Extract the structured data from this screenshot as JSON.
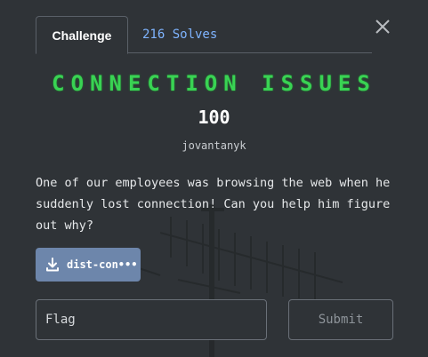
{
  "tabs": {
    "challenge": "Challenge",
    "solves": "216 Solves"
  },
  "challenge": {
    "title": "CONNECTION ISSUES",
    "points": "100",
    "author": "jovantanyk",
    "description": "One of our employees was browsing the web when he suddenly lost connection! Can you help him figure out why?"
  },
  "file": {
    "label": "dist-con•••",
    "icon": "download-icon"
  },
  "form": {
    "flag_placeholder": "Flag",
    "submit_label": "Submit"
  },
  "colors": {
    "title": "#39d353",
    "solves_link": "#7fb4ff",
    "file_button": "#6d86ab",
    "background": "#2f3337"
  }
}
